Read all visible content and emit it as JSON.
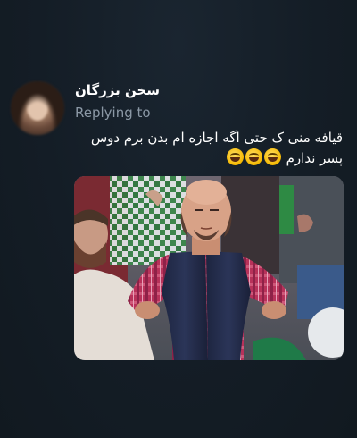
{
  "tweet": {
    "author_name": "سخن بزرگان",
    "replying_label": "Replying to",
    "text_line_1": "قیافه منی ک حتی اگه اجازه ام بدن برم دوس",
    "text_line_2": "پسر ندارم",
    "emoji_count": 3,
    "emoji_icon": "laughing-face-icon"
  },
  "media": {
    "kind": "photo",
    "subject": "man-with-hands-on-hips-in-stadium"
  },
  "colors": {
    "background": "#141d26",
    "text_primary": "#ffffff",
    "text_secondary": "#8b98a5"
  }
}
